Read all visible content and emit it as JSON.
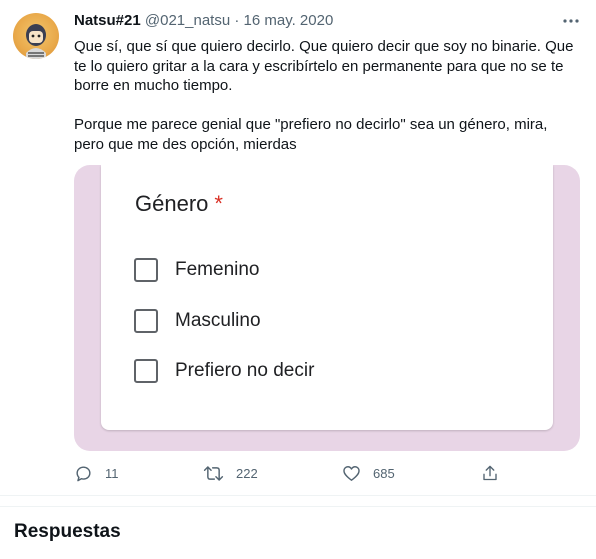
{
  "tweet": {
    "author_name": "Natsu#21",
    "handle": "@021_natsu",
    "separator": "·",
    "date": "16 may. 2020",
    "paragraphs": [
      "Que sí, que sí que quiero decirlo. Que quiero decir que soy no binarie. Que te lo quiero gritar a la cara y escribírtelo en permanente para que no se te borre en mucho tiempo.",
      "Porque me parece genial que \"prefiero no decirlo\" sea un género, mira, pero que me des opción, mierdas"
    ],
    "icons": {
      "more": "more-horizontal-icon",
      "reply": "reply-icon",
      "retweet": "retweet-icon",
      "like": "heart-icon",
      "share": "share-icon"
    },
    "counts": {
      "replies": "11",
      "retweets": "222",
      "likes": "685"
    }
  },
  "form_image": {
    "question": "Género",
    "required_mark": "*",
    "options": [
      "Femenino",
      "Masculino",
      "Prefiero no decir"
    ],
    "background_color": "#e8d5e6"
  },
  "replies_section": {
    "title": "Respuestas"
  },
  "colors": {
    "text_primary": "#0f1419",
    "text_secondary": "#536471",
    "required_red": "#d93025"
  }
}
